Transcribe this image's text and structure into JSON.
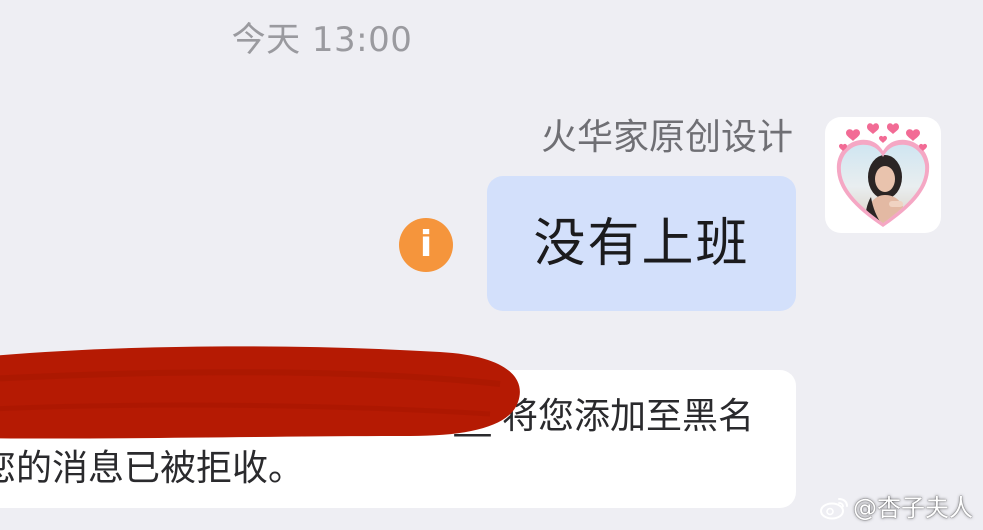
{
  "chat": {
    "timestamp": "今天 13:00",
    "sender_name": "火华家原创设计",
    "message_text": "没有上班",
    "status_icon_glyph": "i",
    "status_color": "#f5953c",
    "bubble_color": "#d3e0fb"
  },
  "system_notice": {
    "line1": "_I4884074__ 将您添加至黑名",
    "line2": "您的消息已被拒收。",
    "redacted": true,
    "redaction_color": "#b51a03"
  },
  "watermark": {
    "text": "@杏子夫人",
    "icon": "weibo-icon"
  }
}
